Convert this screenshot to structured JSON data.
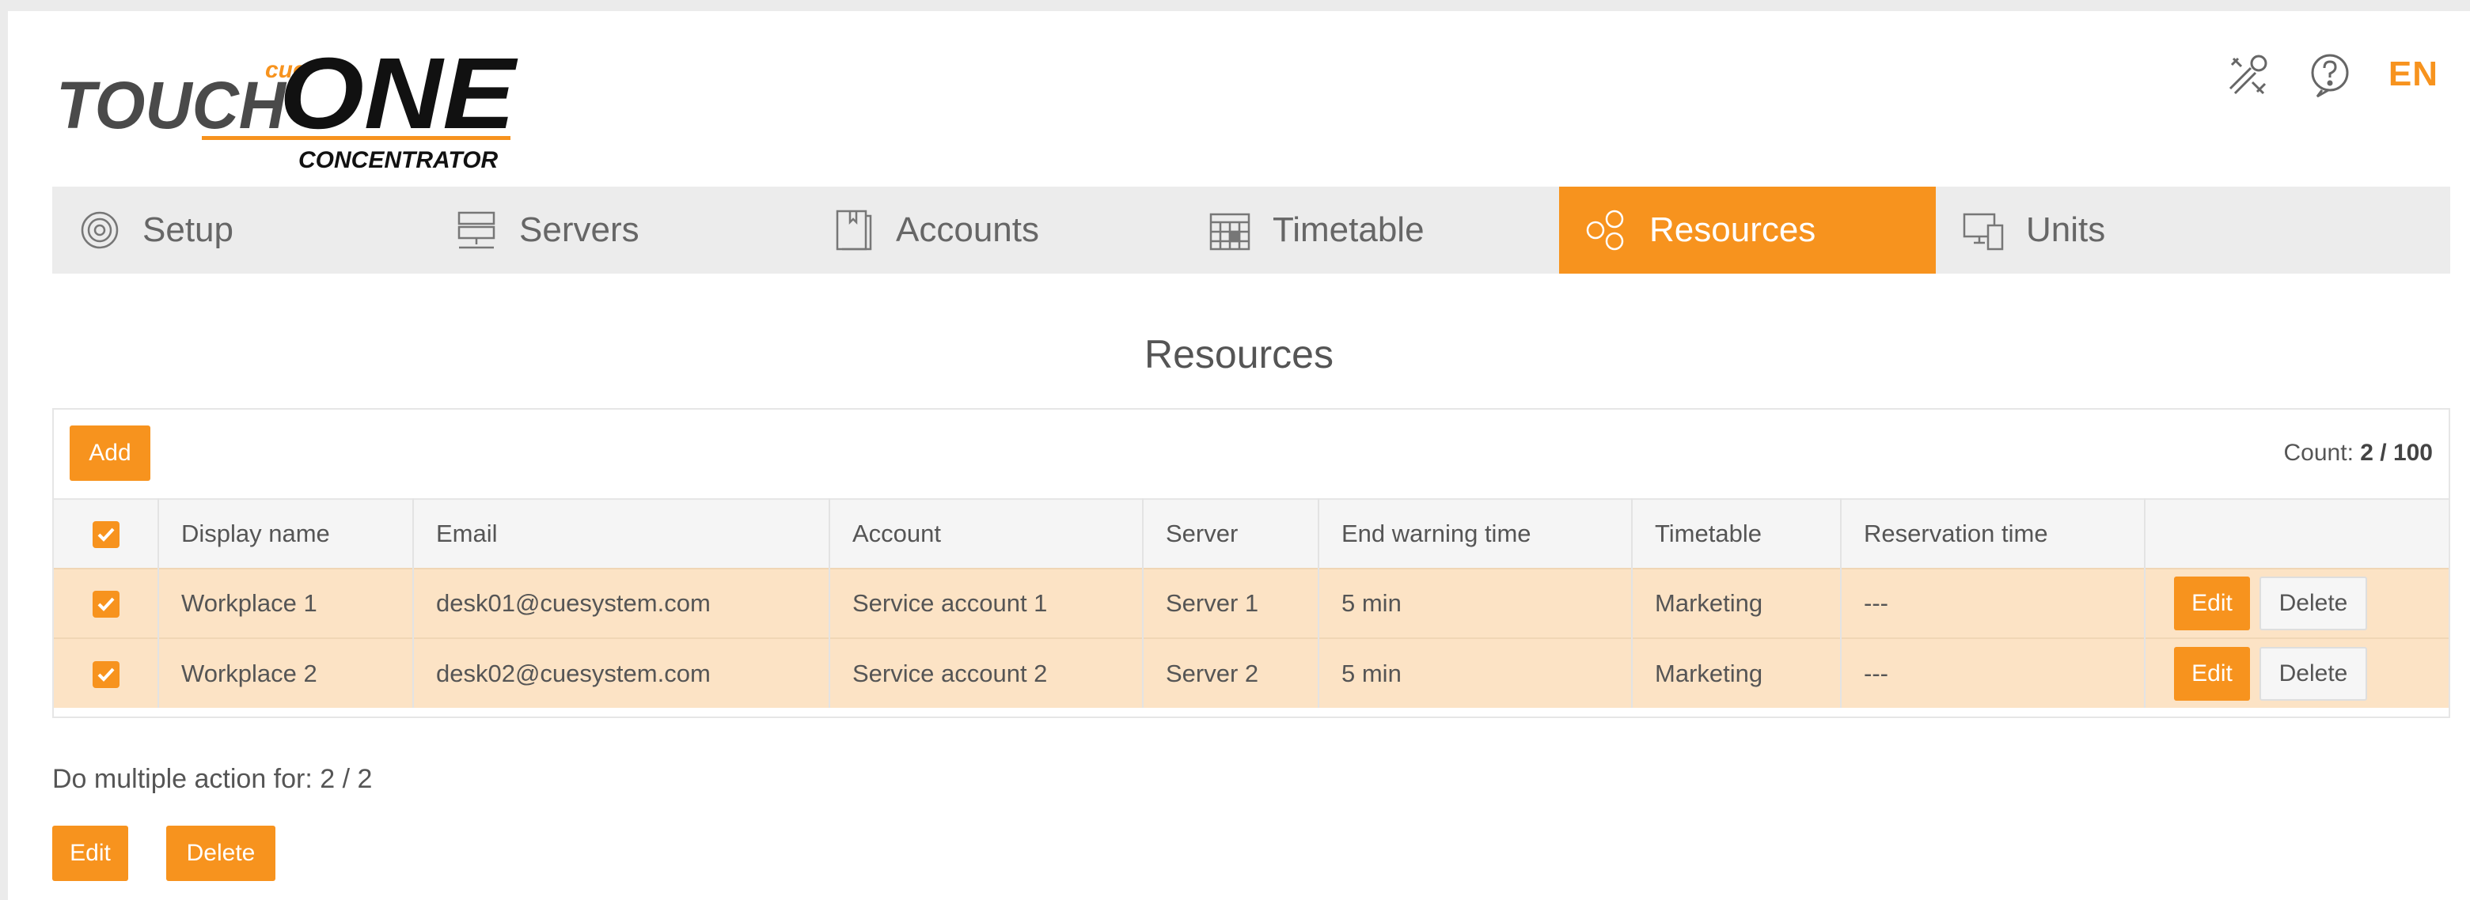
{
  "brand": {
    "logo_cue": "cue",
    "logo_touch": "TOUCH",
    "logo_one": "ONE",
    "logo_sub": "CONCENTRATOR",
    "accent_color": "#f7931e"
  },
  "header": {
    "tools_icon": "tools-icon",
    "help_icon": "help-icon",
    "language": "EN"
  },
  "nav": {
    "tabs": [
      {
        "label": "Setup",
        "icon": "setup-icon",
        "active": false
      },
      {
        "label": "Servers",
        "icon": "servers-icon",
        "active": false
      },
      {
        "label": "Accounts",
        "icon": "accounts-icon",
        "active": false
      },
      {
        "label": "Timetable",
        "icon": "timetable-icon",
        "active": false
      },
      {
        "label": "Resources",
        "icon": "resources-icon",
        "active": true
      },
      {
        "label": "Units",
        "icon": "units-icon",
        "active": false
      }
    ]
  },
  "page": {
    "title": "Resources"
  },
  "toolbar": {
    "add_label": "Add",
    "count_label": "Count:",
    "count_value": "2 / 100"
  },
  "table": {
    "columns": [
      "Display name",
      "Email",
      "Account",
      "Server",
      "End warning time",
      "Timetable",
      "Reservation time"
    ],
    "rows": [
      {
        "selected": true,
        "display_name": "Workplace 1",
        "email": "desk01@cuesystem.com",
        "account": "Service account 1",
        "server": "Server 1",
        "end_warning_time": "5 min",
        "timetable": "Marketing",
        "reservation_time": "---"
      },
      {
        "selected": true,
        "display_name": "Workplace 2",
        "email": "desk02@cuesystem.com",
        "account": "Service account 2",
        "server": "Server 2",
        "end_warning_time": "5 min",
        "timetable": "Marketing",
        "reservation_time": "---"
      }
    ],
    "edit_label": "Edit",
    "delete_label": "Delete"
  },
  "multi": {
    "label": "Do multiple action for: 2 / 2",
    "edit_label": "Edit",
    "delete_label": "Delete"
  }
}
